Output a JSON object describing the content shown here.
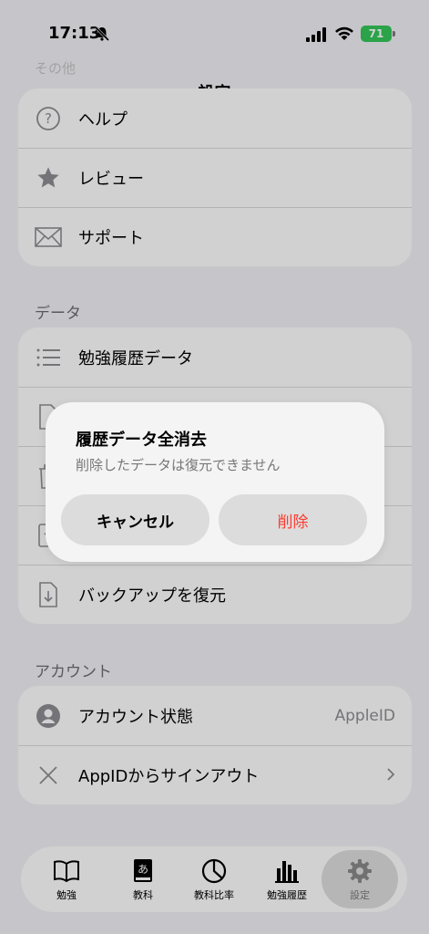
{
  "status": {
    "time": "17:13",
    "battery": "71"
  },
  "nav": {
    "title": "設定",
    "faded_section": "その他"
  },
  "other_rows": [
    {
      "label": "ヘルプ",
      "icon": "question-circle-icon"
    },
    {
      "label": "レビュー",
      "icon": "star-icon"
    },
    {
      "label": "サポート",
      "icon": "envelope-icon"
    }
  ],
  "data_section": {
    "label": "データ",
    "rows": [
      {
        "label": "勉強履歴データ",
        "icon": "list-icon"
      },
      {
        "label": "",
        "icon": "document-icon"
      },
      {
        "label": "",
        "icon": "trash-icon"
      },
      {
        "label": "",
        "icon": "backup-icon"
      },
      {
        "label": "バックアップを復元",
        "icon": "restore-document-icon"
      }
    ]
  },
  "account_section": {
    "label": "アカウント",
    "status_label": "アカウント状態",
    "status_value": "AppleID",
    "signout_label": "AppIDからサインアウト"
  },
  "dialog": {
    "title": "履歴データ全消去",
    "message": "削除したデータは復元できません",
    "cancel": "キャンセル",
    "delete": "削除",
    "delete_color": "#ff3b30"
  },
  "tabbar": {
    "tabs": [
      {
        "label": "勉強",
        "icon": "book-icon"
      },
      {
        "label": "教科",
        "icon": "kana-book-icon",
        "glyph": "あ"
      },
      {
        "label": "教科比率",
        "icon": "pie-chart-icon"
      },
      {
        "label": "勉強履歴",
        "icon": "bar-chart-icon"
      },
      {
        "label": "設定",
        "icon": "gear-icon",
        "active": true
      }
    ]
  }
}
